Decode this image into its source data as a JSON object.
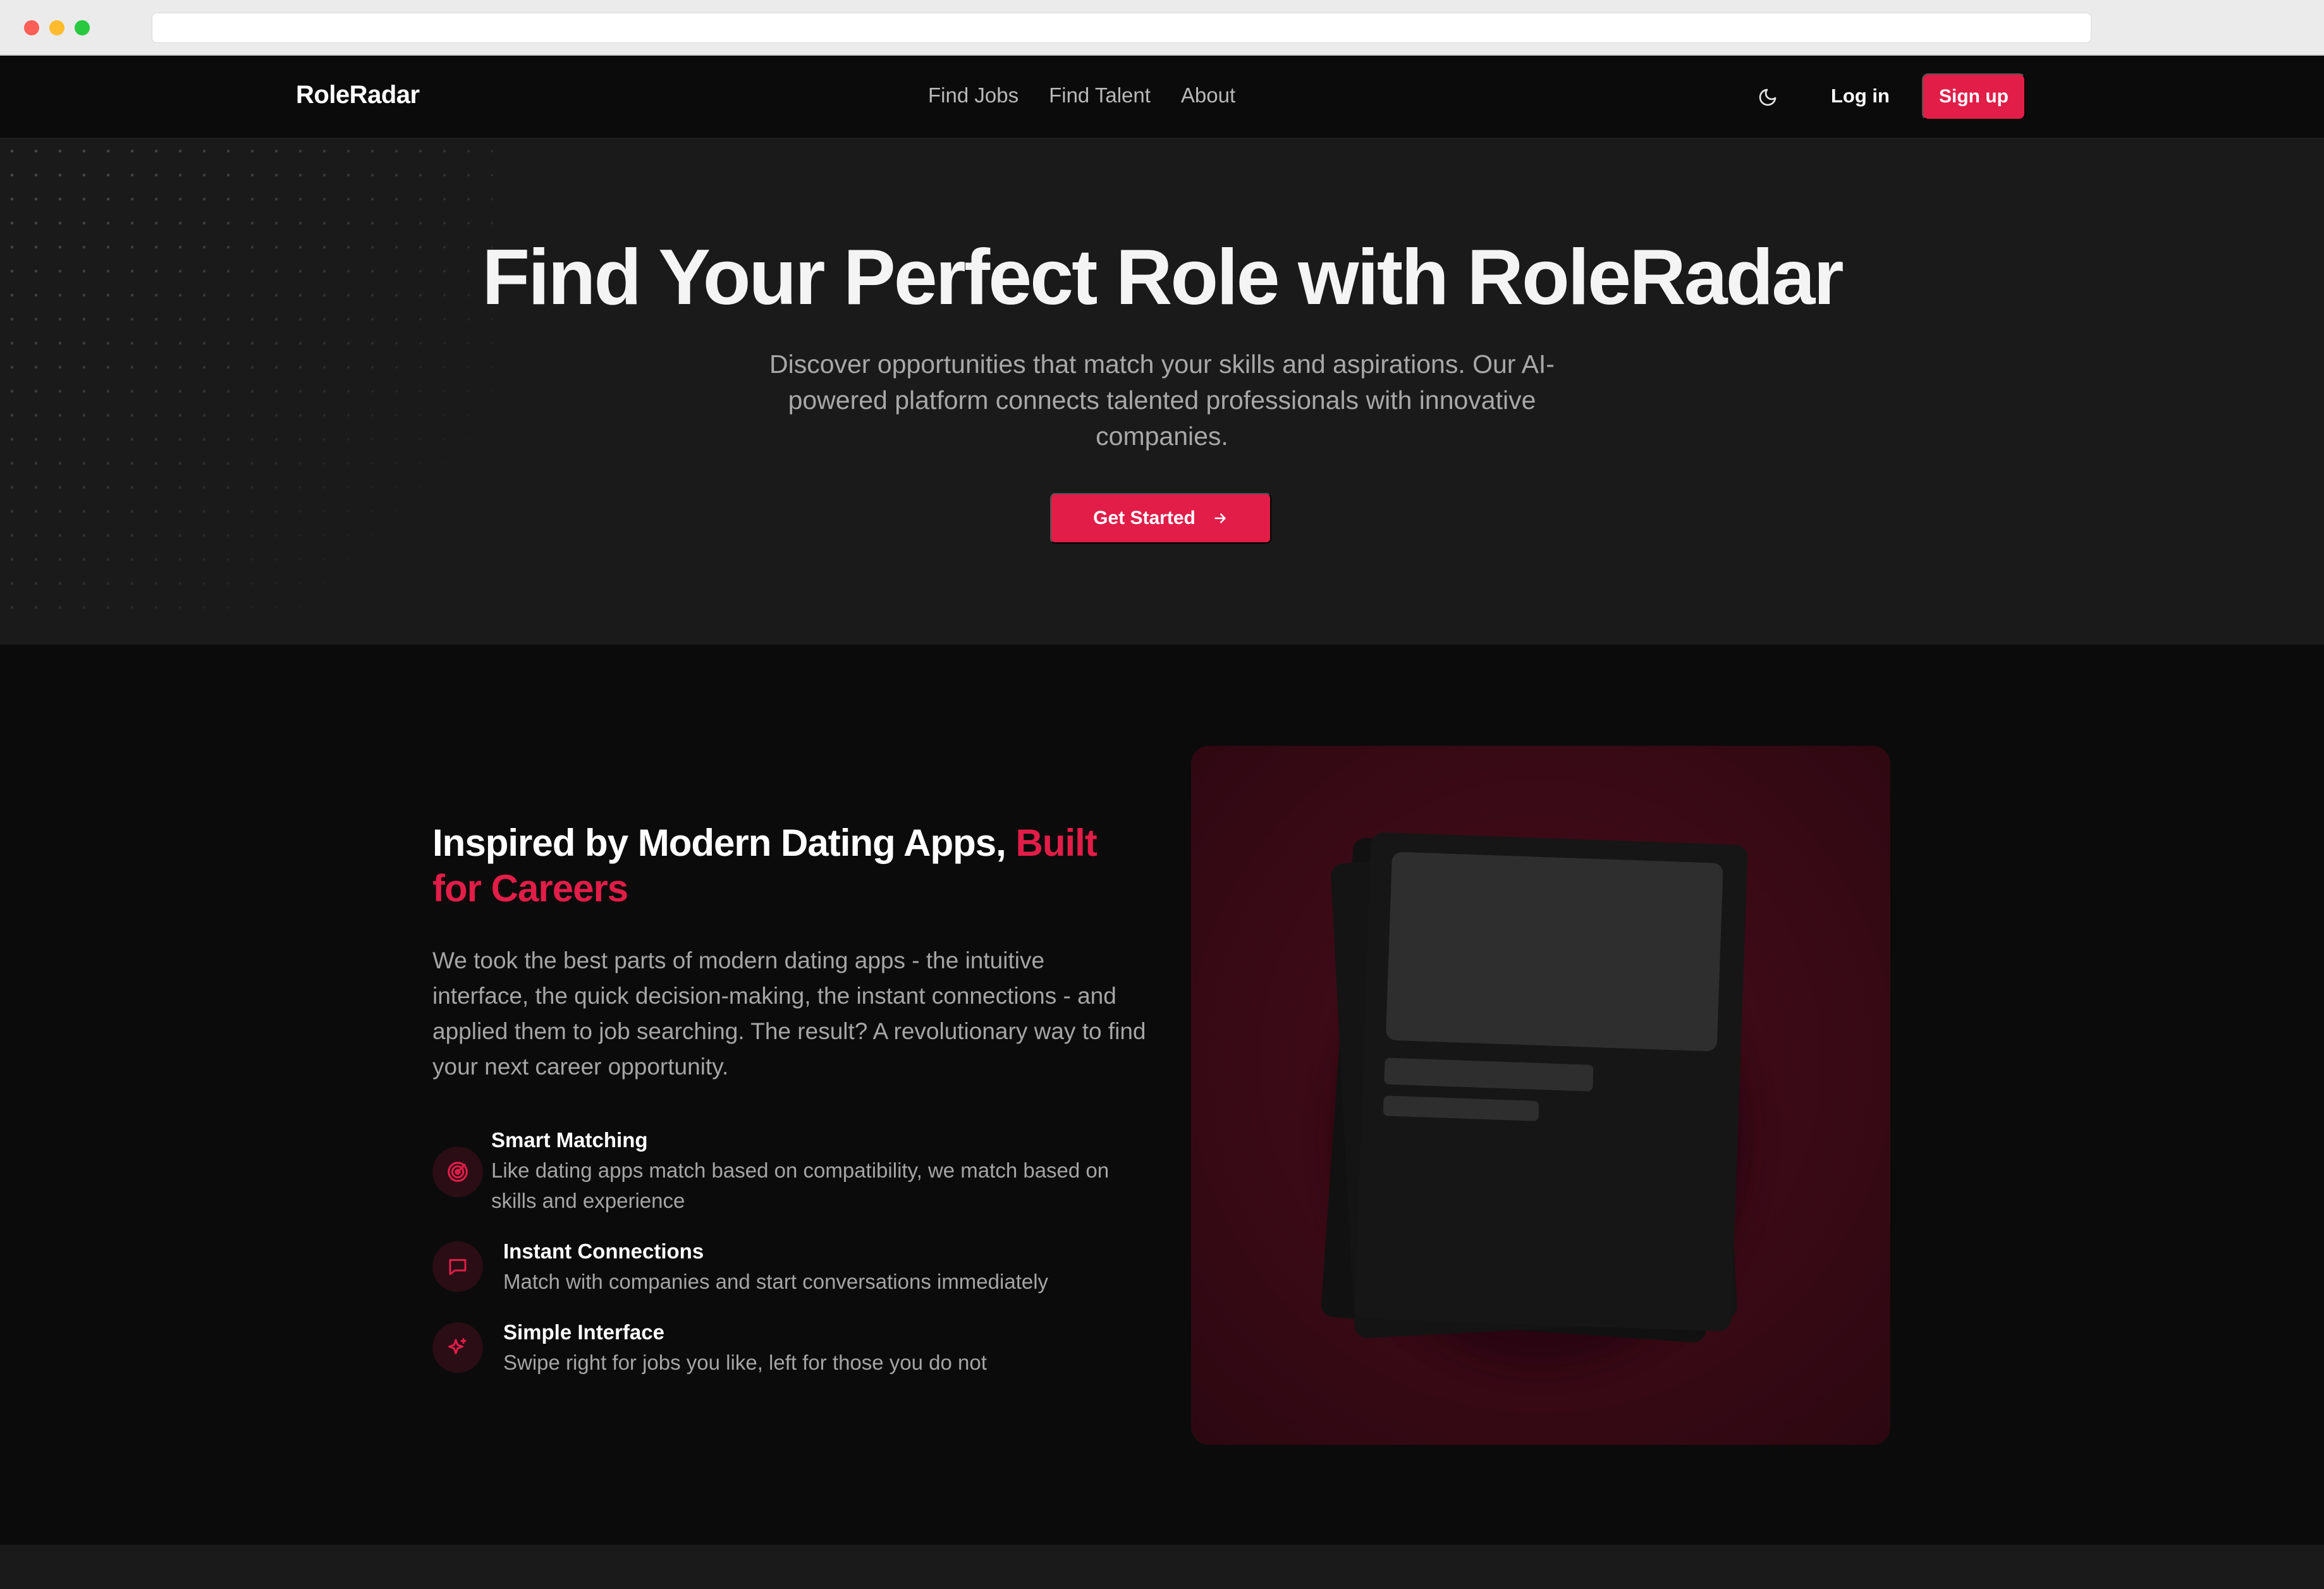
{
  "nav": {
    "logo": "RoleRadar",
    "links": [
      "Find Jobs",
      "Find Talent",
      "About"
    ],
    "login": "Log in",
    "signup": "Sign up"
  },
  "hero": {
    "title": "Find Your Perfect Role with RoleRadar",
    "subtitle": "Discover opportunities that match your skills and aspirations. Our AI-powered platform connects talented professionals with innovative companies.",
    "cta": "Get Started"
  },
  "feature": {
    "title_main": "Inspired by Modern Dating Apps,",
    "title_accent": "Built for Careers",
    "body": "We took the best parts of modern dating apps - the intuitive interface, the quick decision-making, the instant connections - and applied them to job searching. The result? A revolutionary way to find your next career opportunity.",
    "items": [
      {
        "icon": "target-icon",
        "title": "Smart Matching",
        "desc": "Like dating apps match based on compatibility, we match based on skills and experience"
      },
      {
        "icon": "chat-icon",
        "title": "Instant Connections",
        "desc": "Match with companies and start conversations immediately"
      },
      {
        "icon": "sparkles-icon",
        "title": "Simple Interface",
        "desc": "Swipe right for jobs you like, left for those you do not"
      }
    ]
  },
  "colors": {
    "accent": "#e11d48",
    "background": "#0b0b0b",
    "hero_bg": "#1a1a1b"
  }
}
